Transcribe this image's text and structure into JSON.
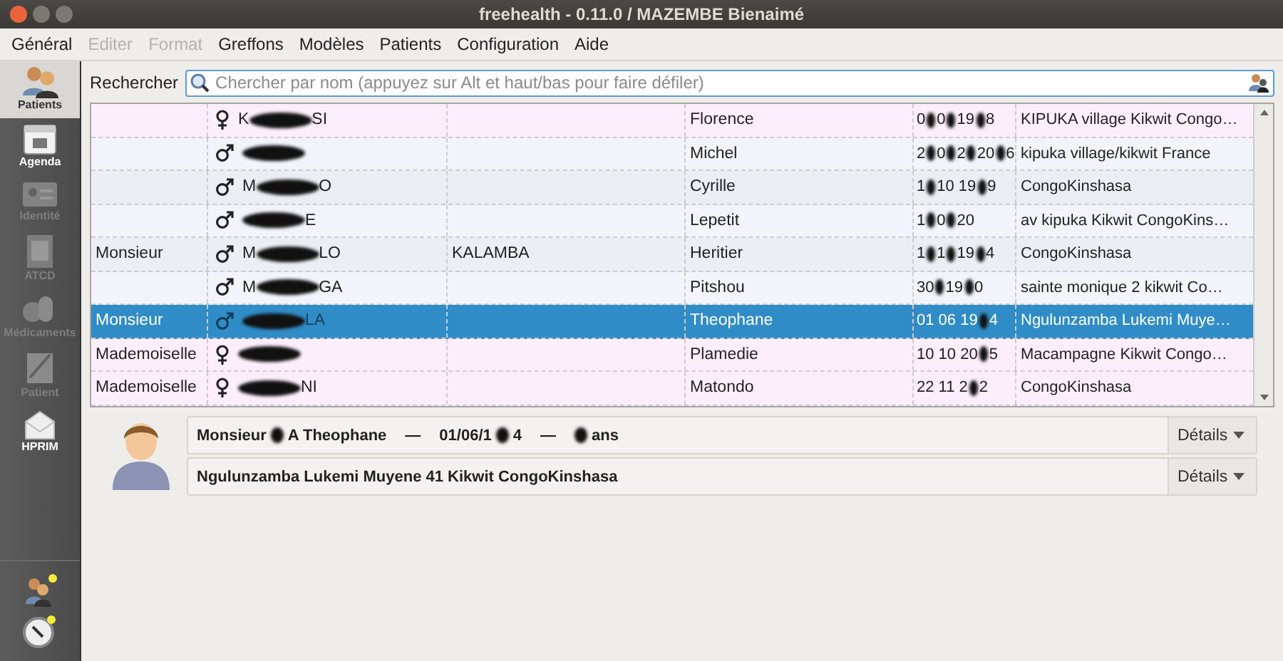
{
  "window": {
    "title": "freehealth - 0.11.0 /  MAZEMBE Bienaimé"
  },
  "menu": [
    {
      "label": "Général",
      "disabled": false
    },
    {
      "label": "Editer",
      "disabled": true
    },
    {
      "label": "Format",
      "disabled": true
    },
    {
      "label": "Greffons",
      "disabled": false
    },
    {
      "label": "Modèles",
      "disabled": false
    },
    {
      "label": "Patients",
      "disabled": false
    },
    {
      "label": "Configuration",
      "disabled": false
    },
    {
      "label": "Aide",
      "disabled": false
    }
  ],
  "sidebar": [
    {
      "label": "Patients",
      "kind": "patients",
      "selected": true,
      "disabled": false
    },
    {
      "label": "Agenda",
      "kind": "agenda",
      "selected": false,
      "disabled": false
    },
    {
      "label": "Identité",
      "kind": "identity",
      "selected": false,
      "disabled": true
    },
    {
      "label": "ATCD",
      "kind": "atcd",
      "selected": false,
      "disabled": true
    },
    {
      "label": "Médicaments",
      "kind": "drugs",
      "selected": false,
      "disabled": true
    },
    {
      "label": "Patient",
      "kind": "patient",
      "selected": false,
      "disabled": true
    },
    {
      "label": "HPRIM",
      "kind": "hprim",
      "selected": false,
      "disabled": false
    }
  ],
  "search": {
    "label": "Rechercher",
    "placeholder": "Chercher par nom (appuyez sur Alt et haut/bas pour faire défiler)"
  },
  "rows": [
    {
      "title": "",
      "kind": "female",
      "name": {
        "start": "K",
        "end": "SI"
      },
      "column_3": "",
      "firstname": "Florence",
      "dob": [
        "0",
        "0",
        "19",
        "8"
      ],
      "address": "KIPUKA village Kikwit Congo…",
      "selected": false
    },
    {
      "title": "",
      "kind": "male",
      "name": {},
      "column_3": "",
      "firstname": "Michel",
      "dob": [
        "2",
        "0",
        "2",
        "20",
        "6"
      ],
      "address": "kipuka village/kikwit France",
      "selected": false
    },
    {
      "title": "",
      "kind": "male",
      "name": {
        "start": "M",
        "end": "O"
      },
      "column_3": "",
      "firstname": "Cyrille",
      "dob": [
        "1",
        "10 19",
        "9"
      ],
      "address": "CongoKinshasa",
      "selected": false
    },
    {
      "title": "",
      "kind": "male",
      "name": {
        "end": "E"
      },
      "column_3": "",
      "firstname": "Lepetit",
      "dob": [
        "1",
        "0",
        "20"
      ],
      "address": "av kipuka Kikwit CongoKins…",
      "selected": false
    },
    {
      "title": "Monsieur",
      "kind": "male",
      "name": {
        "start": "M",
        "end": "LO"
      },
      "column_3": "KALAMBA",
      "firstname": "Heritier",
      "dob": [
        "1",
        "1",
        "19",
        "4"
      ],
      "address": "CongoKinshasa",
      "selected": false
    },
    {
      "title": "",
      "kind": "male",
      "name": {
        "start": "M",
        "end": "GA"
      },
      "column_3": "",
      "firstname": "Pitshou",
      "dob": [
        "30",
        "19",
        "0"
      ],
      "address": "sainte monique 2 kikwit Co…",
      "selected": false
    },
    {
      "title": "Monsieur",
      "kind": "male",
      "name": {
        "end": "LA"
      },
      "column_3": "",
      "firstname": "Theophane",
      "dob": [
        "01 06 19",
        "4"
      ],
      "address": "Ngulunzamba Lukemi Muye…",
      "selected": true
    },
    {
      "title": "Mademoiselle",
      "kind": "female",
      "name": {},
      "column_3": "",
      "firstname": "Plamedie",
      "dob": [
        "10 10 20",
        "5"
      ],
      "address": "Macampagne Kikwit Congo…",
      "selected": false
    },
    {
      "title": "Mademoiselle",
      "kind": "female",
      "name": {
        "end": "NI"
      },
      "column_3": "",
      "firstname": "Matondo",
      "dob": [
        "22 11 2",
        "2"
      ],
      "address": "CongoKinshasa",
      "selected": false
    }
  ],
  "summary": {
    "identity": [
      {
        "kind": "text",
        "text": "Monsieur"
      },
      {
        "kind": "redacted"
      },
      {
        "kind": "text",
        "text": "A Theophane"
      },
      {
        "kind": "dash",
        "text": "—"
      },
      {
        "kind": "text",
        "text": "01/06/1"
      },
      {
        "kind": "redacted"
      },
      {
        "kind": "text",
        "text": "4"
      },
      {
        "kind": "dash",
        "text": "—"
      },
      {
        "kind": "redacted"
      },
      {
        "kind": "text",
        "text": "ans"
      }
    ],
    "address": "Ngulunzamba Lukemi Muyene 41 Kikwit CongoKinshasa",
    "details": [
      "Détails",
      "Détails"
    ]
  }
}
